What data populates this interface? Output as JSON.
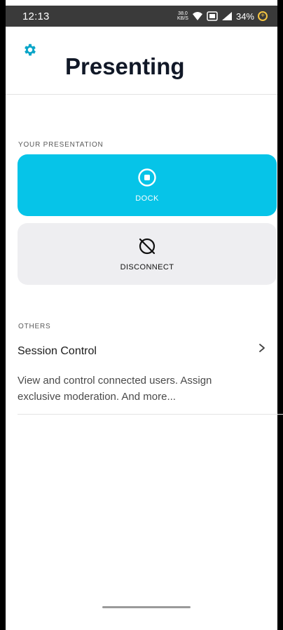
{
  "status_bar": {
    "time": "12:13",
    "net_speed_value": "38.0",
    "net_speed_unit": "KB/S",
    "battery": "34%"
  },
  "header": {
    "title": "Presenting",
    "settings_icon": "gear-icon"
  },
  "your_presentation": {
    "section_label": "YOUR PRESENTATION",
    "dock": {
      "label": "DOCK",
      "icon": "stop-circle-icon",
      "color": "#06c4e8"
    },
    "disconnect": {
      "label": "DISCONNECT",
      "icon": "link-off-icon",
      "color": "#eeeef1"
    }
  },
  "others": {
    "section_label": "OTHERS",
    "session_control": {
      "title": "Session Control",
      "description": "View and control connected users. Assign exclusive moderation. And more...",
      "icon": "chevron-right-icon"
    }
  },
  "colors": {
    "accent": "#06c4e8",
    "title": "#111827",
    "status_bar": "#3a3a3a"
  }
}
